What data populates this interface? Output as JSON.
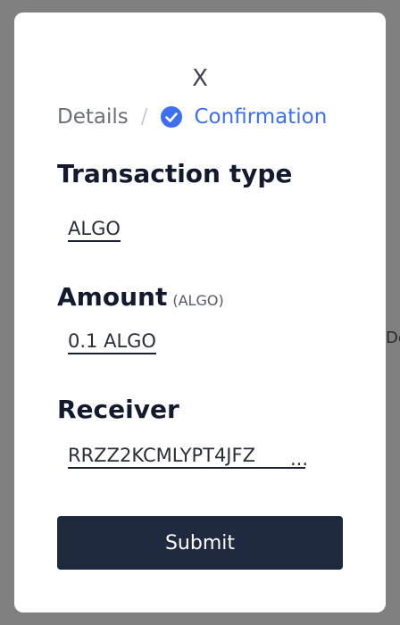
{
  "background": {
    "peek_text": "De"
  },
  "modal": {
    "close_label": "X",
    "steps": {
      "step1": "Details",
      "separator": "/",
      "step2": "Confirmation"
    },
    "transaction_type": {
      "label": "Transaction type",
      "value": "ALGO"
    },
    "amount": {
      "label": "Amount",
      "unit": "(ALGO)",
      "value": "0.1 ALGO"
    },
    "receiver": {
      "label": "Receiver",
      "value": "RRZZ2KCMLYPT4JFZ",
      "ellipsis": "..."
    },
    "submit_label": "Submit"
  },
  "colors": {
    "accent": "#3e6ef2",
    "button": "#1f2a40",
    "overlay": "#808080"
  }
}
